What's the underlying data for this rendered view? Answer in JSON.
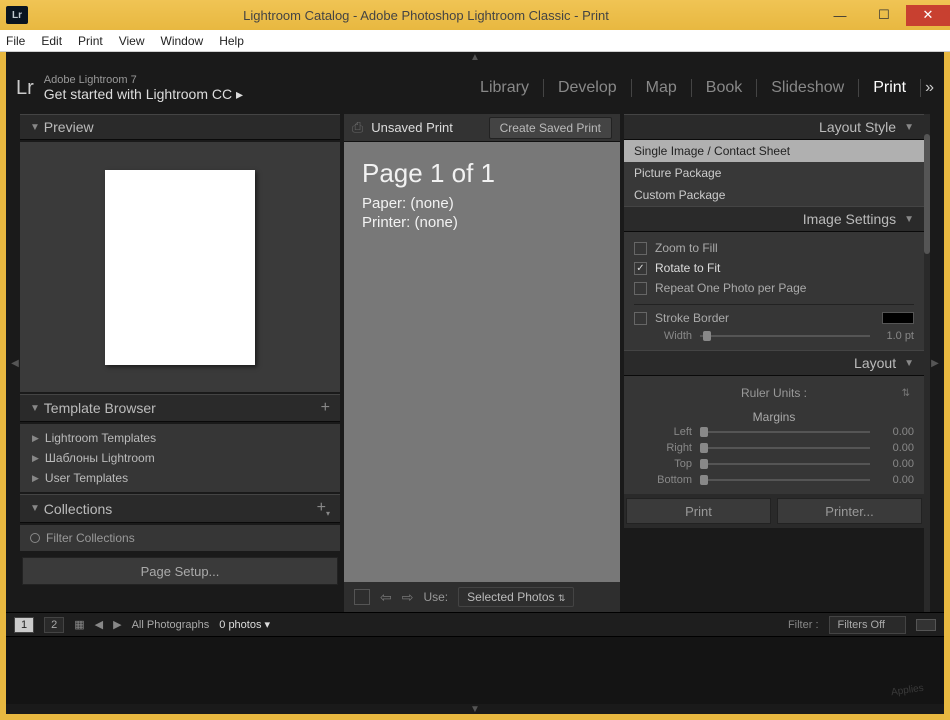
{
  "window": {
    "title": "Lightroom Catalog - Adobe Photoshop Lightroom Classic - Print",
    "icon_text": "Lr"
  },
  "menubar": [
    "File",
    "Edit",
    "Print",
    "View",
    "Window",
    "Help"
  ],
  "header": {
    "logo": "Lr",
    "product_line": "Adobe Lightroom 7",
    "tagline": "Get started with Lightroom CC ▸",
    "modules": [
      "Library",
      "Develop",
      "Map",
      "Book",
      "Slideshow",
      "Print"
    ],
    "active_module": "Print",
    "chevrons": "»"
  },
  "left": {
    "preview_title": "Preview",
    "template_browser_title": "Template Browser",
    "templates": [
      "Lightroom Templates",
      "Шаблоны Lightroom",
      "User Templates"
    ],
    "collections_title": "Collections",
    "filter_collections_label": "Filter Collections",
    "page_setup_label": "Page Setup..."
  },
  "center": {
    "unsaved_label": "Unsaved Print",
    "create_saved_label": "Create Saved Print",
    "page_heading": "Page 1 of 1",
    "paper_line": "Paper: (none)",
    "printer_line": "Printer: (none)",
    "use_label": "Use:",
    "use_value": "Selected Photos"
  },
  "right": {
    "layout_style_title": "Layout Style",
    "layout_styles": [
      "Single Image / Contact Sheet",
      "Picture Package",
      "Custom Package"
    ],
    "selected_style_index": 0,
    "image_settings_title": "Image Settings",
    "zoom_to_fill": "Zoom to Fill",
    "rotate_to_fit": "Rotate to Fit",
    "repeat_one": "Repeat One Photo per Page",
    "stroke_border": "Stroke Border",
    "stroke_width_label": "Width",
    "stroke_width_val": "1.0 pt",
    "layout_title": "Layout",
    "ruler_units": "Ruler Units :",
    "margins_title": "Margins",
    "margin_left_label": "Left",
    "margin_right_label": "Right",
    "margin_top_label": "Top",
    "margin_bottom_label": "Bottom",
    "margin_val": "0.00",
    "print_btn": "Print",
    "printer_btn": "Printer..."
  },
  "filmstrip": {
    "view1": "1",
    "view2": "2",
    "source": "All Photographs",
    "count": "0 photos",
    "filter_label": "Filter :",
    "filter_value": "Filters Off"
  }
}
